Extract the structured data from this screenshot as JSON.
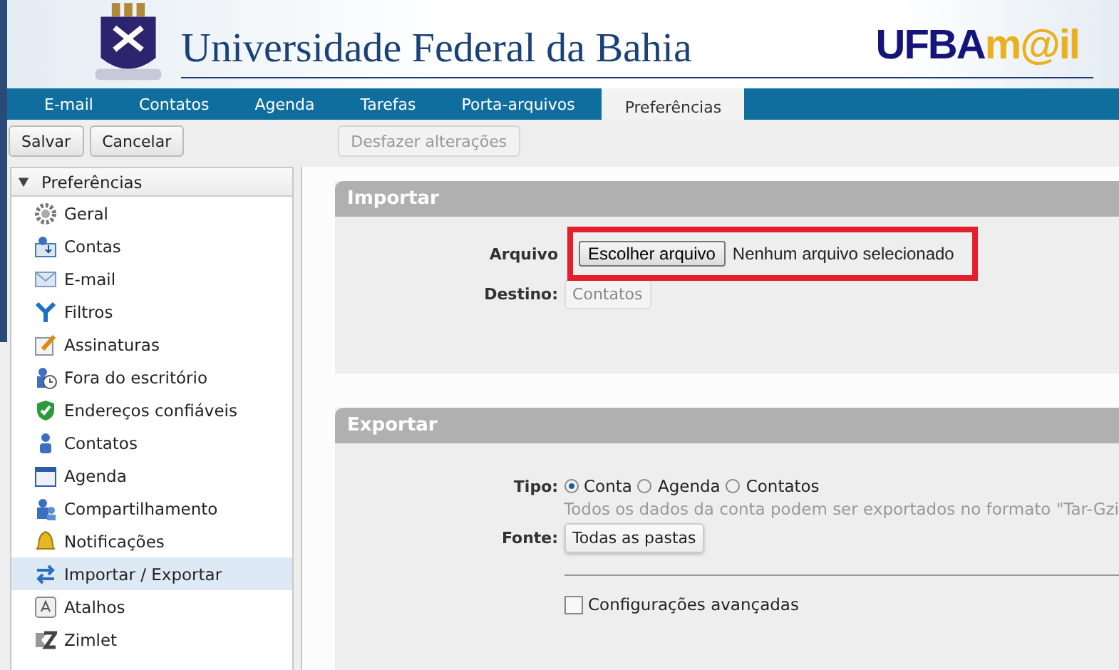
{
  "header": {
    "title": "Universidade Federal da Bahia",
    "logo_main": "UFBA",
    "logo_accent": "m@il"
  },
  "tabs": [
    {
      "label": "E-mail",
      "selected": false
    },
    {
      "label": "Contatos",
      "selected": false
    },
    {
      "label": "Agenda",
      "selected": false
    },
    {
      "label": "Tarefas",
      "selected": false
    },
    {
      "label": "Porta-arquivos",
      "selected": false
    },
    {
      "label": "Preferências",
      "selected": true
    }
  ],
  "toolbar": [
    {
      "label": "Salvar",
      "disabled": false
    },
    {
      "label": "Cancelar",
      "disabled": false
    },
    {
      "label": "Desfazer alterações",
      "disabled": true
    }
  ],
  "sidebar": {
    "title": "Preferências",
    "expanded": true,
    "items": [
      {
        "label": "Geral",
        "selected": false
      },
      {
        "label": "Contas",
        "selected": false
      },
      {
        "label": "E-mail",
        "selected": false
      },
      {
        "label": "Filtros",
        "selected": false
      },
      {
        "label": "Assinaturas",
        "selected": false
      },
      {
        "label": "Fora do escritório",
        "selected": false
      },
      {
        "label": "Endereços confiáveis",
        "selected": false
      },
      {
        "label": "Contatos",
        "selected": false
      },
      {
        "label": "Agenda",
        "selected": false
      },
      {
        "label": "Compartilhamento",
        "selected": false
      },
      {
        "label": "Notificações",
        "selected": false
      },
      {
        "label": "Importar / Exportar",
        "selected": true
      },
      {
        "label": "Atalhos",
        "selected": false
      },
      {
        "label": "Zimlet",
        "selected": false
      }
    ]
  },
  "import": {
    "title": "Importar",
    "file_label": "Arquivo",
    "file_button": "Escolher arquivo",
    "file_status": "Nenhum arquivo selecionado",
    "highlighted": true,
    "dest_label": "Destino:",
    "dest_button": "Contatos",
    "dest_disabled": true
  },
  "export": {
    "title": "Exportar",
    "type_label": "Tipo:",
    "types": [
      {
        "label": "Conta",
        "selected": true
      },
      {
        "label": "Agenda",
        "selected": false
      },
      {
        "label": "Contatos",
        "selected": false
      }
    ],
    "hint": "Todos os dados da conta podem ser exportados no formato \"Tar-Gzi",
    "source_label": "Fonte:",
    "source_button": "Todas as pastas",
    "advanced": {
      "label": "Configurações avançadas",
      "checked": false
    }
  }
}
